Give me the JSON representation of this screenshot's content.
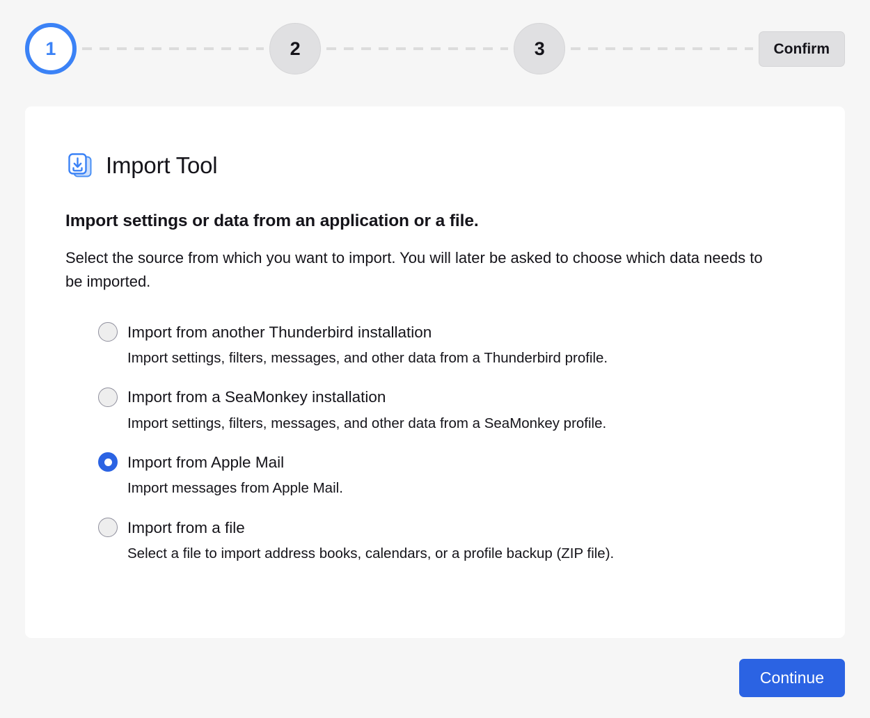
{
  "wizard": {
    "steps": [
      {
        "label": "1",
        "state": "current"
      },
      {
        "label": "2",
        "state": "pending"
      },
      {
        "label": "3",
        "state": "pending"
      }
    ],
    "confirm_label": "Confirm"
  },
  "card": {
    "icon": "import-file-download-icon",
    "title": "Import Tool",
    "subheading": "Import settings or data from an application or a file.",
    "description": "Select the source from which you want to import. You will later be asked to choose which data needs to be imported.",
    "options": [
      {
        "label": "Import from another Thunderbird installation",
        "description": "Import settings, filters, messages, and other data from a Thunderbird profile.",
        "selected": false
      },
      {
        "label": "Import from a SeaMonkey installation",
        "description": "Import settings, filters, messages, and other data from a SeaMonkey profile.",
        "selected": false
      },
      {
        "label": "Import from Apple Mail",
        "description": "Import messages from Apple Mail.",
        "selected": true
      },
      {
        "label": "Import from a file",
        "description": "Select a file to import address books, calendars, or a profile backup (ZIP file).",
        "selected": false
      }
    ]
  },
  "footer": {
    "continue_label": "Continue"
  },
  "colors": {
    "accent_blue": "#2b63e3",
    "step_current_blue": "#3b82f6",
    "page_background": "#f6f6f6",
    "card_background": "#ffffff",
    "pending_grey": "#e0e0e2"
  }
}
